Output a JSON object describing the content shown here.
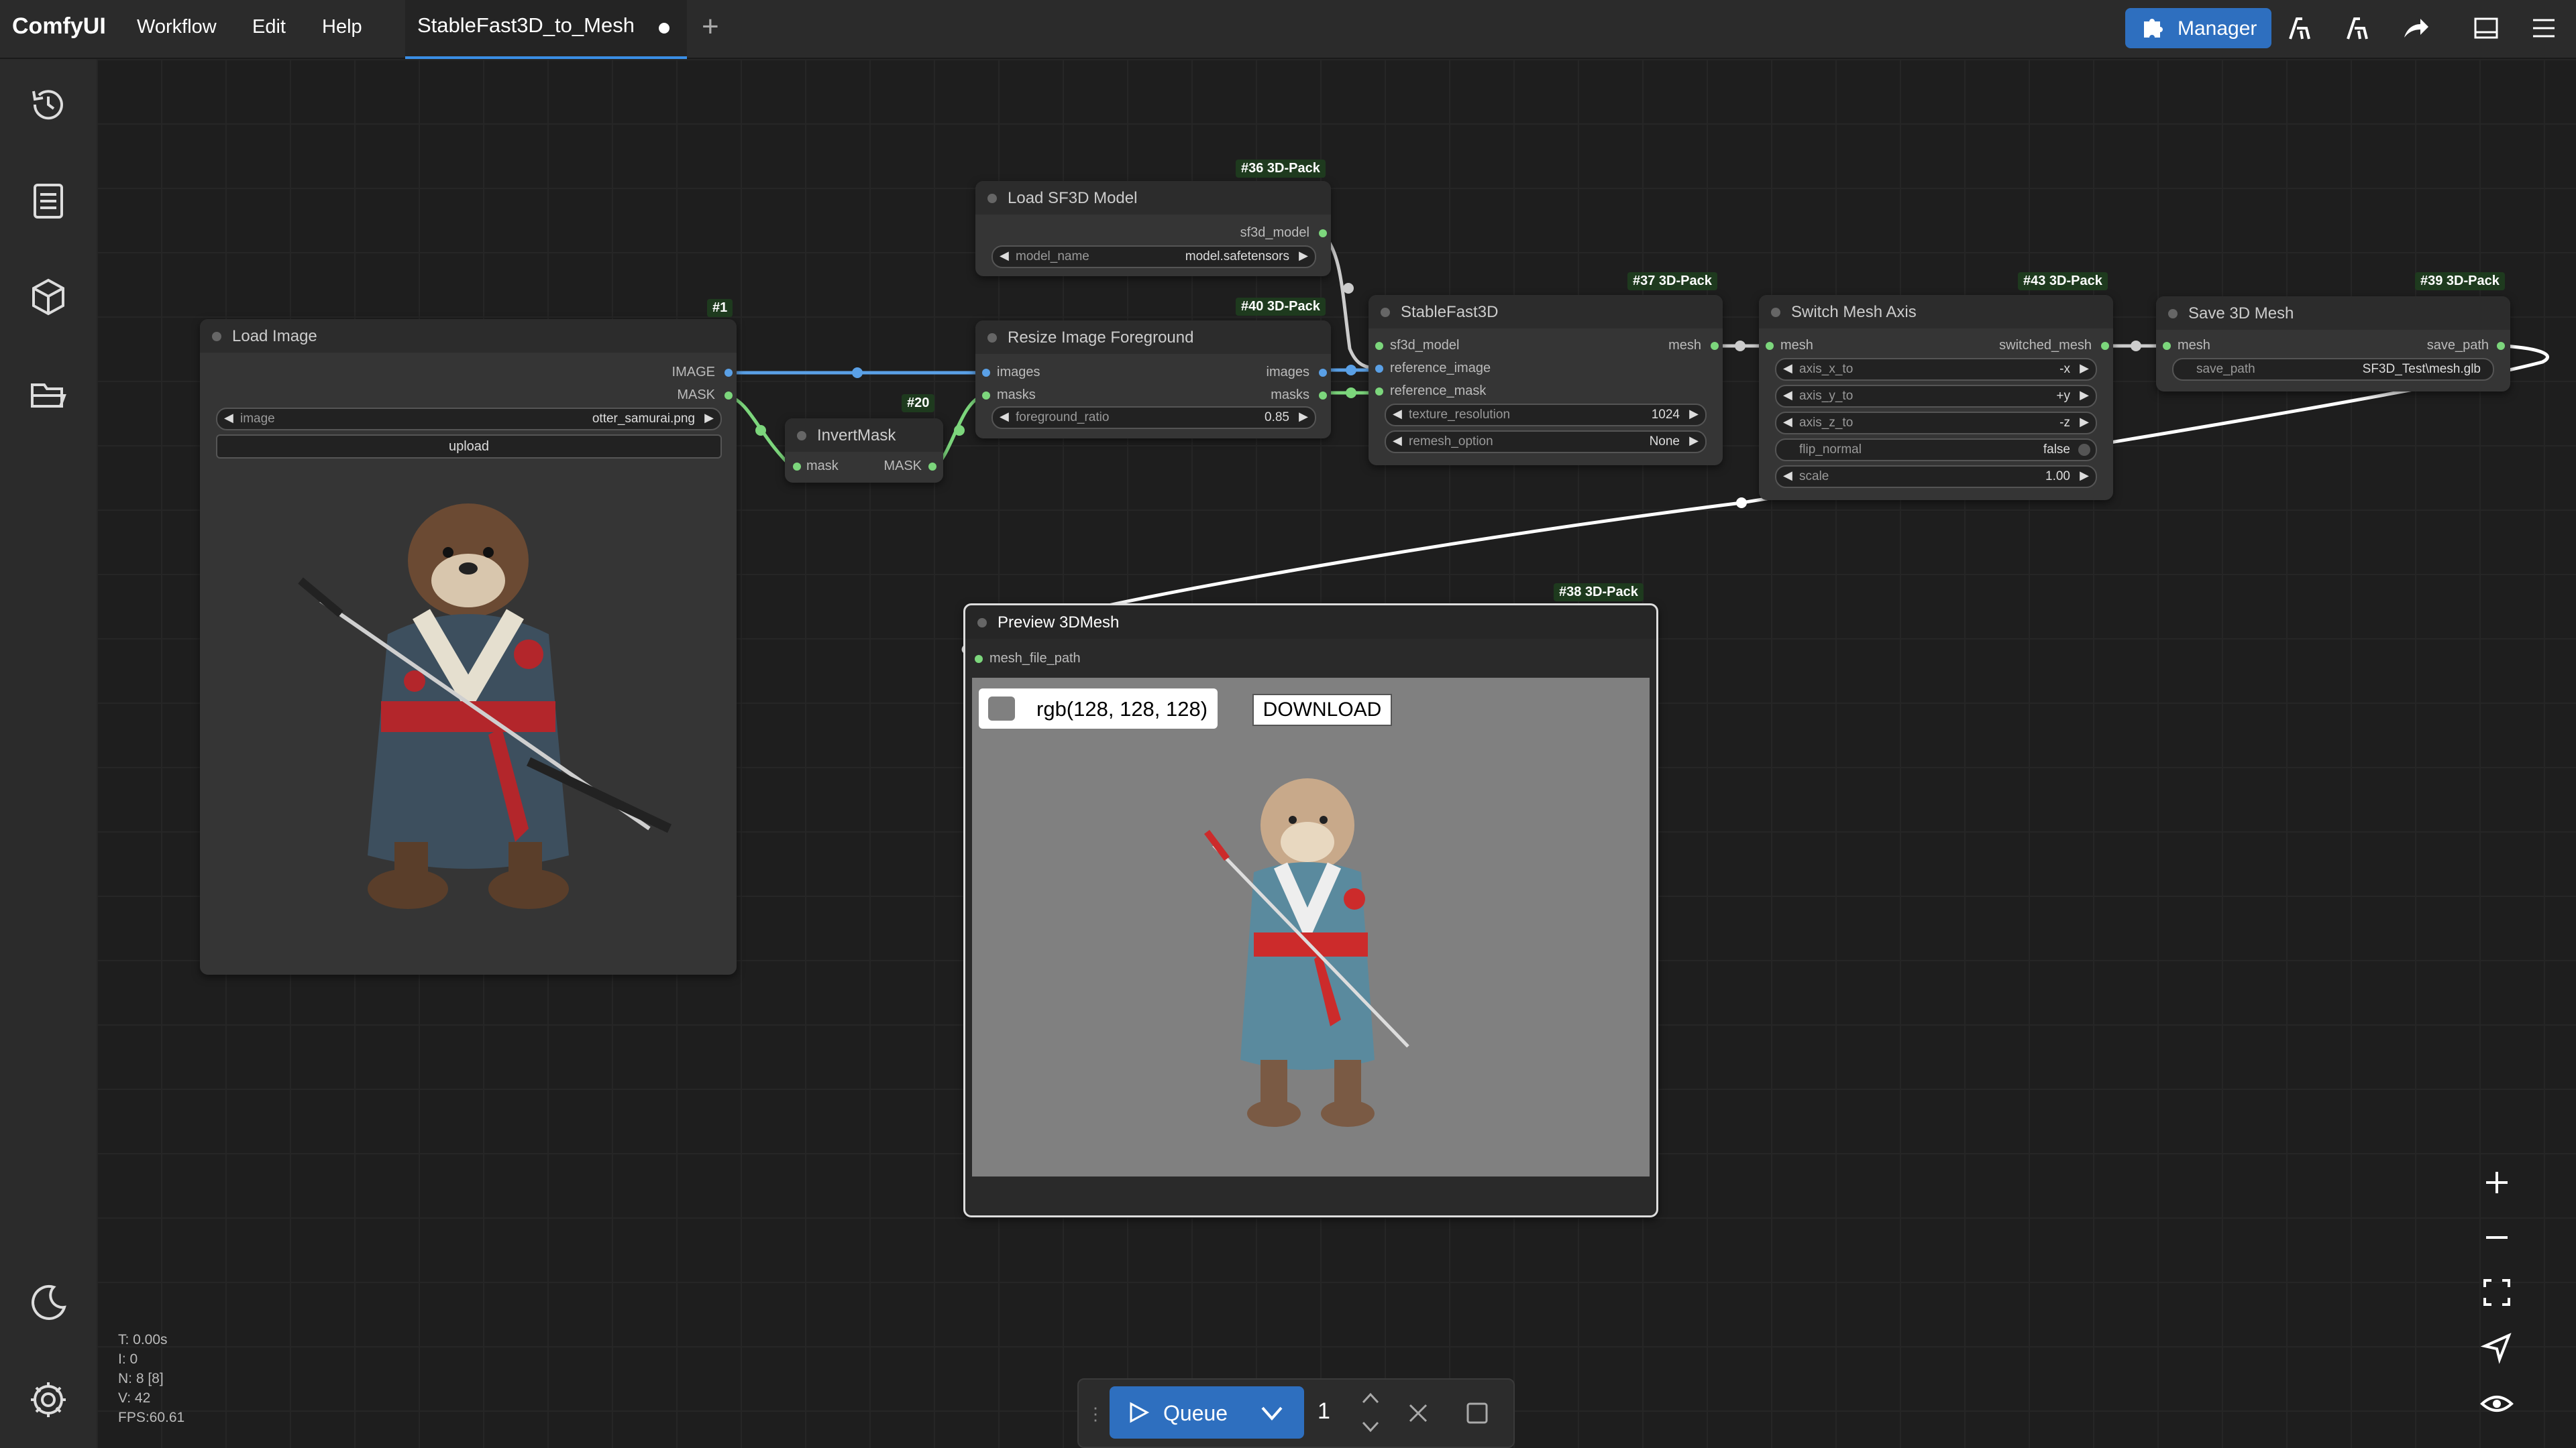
{
  "app": {
    "name": "ComfyUI"
  },
  "menu": {
    "workflow": "Workflow",
    "edit": "Edit",
    "help": "Help"
  },
  "tabs": [
    {
      "label": "StableFast3D_to_Mesh"
    }
  ],
  "toolbar": {
    "manager_label": "Manager"
  },
  "sidebar": {
    "items": [
      "history-icon",
      "queue-icon",
      "model-library-icon",
      "workflows-icon"
    ],
    "bottom": [
      "theme-toggle-icon",
      "settings-icon"
    ]
  },
  "nodes": {
    "load_image": {
      "title": "Load Image",
      "badge": "#1",
      "outputs": [
        "IMAGE",
        "MASK"
      ],
      "widget_image_label": "image",
      "widget_image_value": "otter_samurai.png",
      "upload_label": "upload"
    },
    "load_sf3d": {
      "title": "Load SF3D Model",
      "badge": "#36 3D-Pack",
      "output": "sf3d_model",
      "widget_label": "model_name",
      "widget_value": "model.safetensors"
    },
    "invert_mask": {
      "title": "InvertMask",
      "badge": "#20",
      "input": "mask",
      "output": "MASK"
    },
    "resize_fg": {
      "title": "Resize Image Foreground",
      "badge": "#40 3D-Pack",
      "inputs": [
        "images",
        "masks"
      ],
      "outputs": [
        "images",
        "masks"
      ],
      "widget_label": "foreground_ratio",
      "widget_value": "0.85"
    },
    "stablefast3d": {
      "title": "StableFast3D",
      "badge": "#37 3D-Pack",
      "inputs": [
        "sf3d_model",
        "reference_image",
        "reference_mask"
      ],
      "output": "mesh",
      "w1_label": "texture_resolution",
      "w1_value": "1024",
      "w2_label": "remesh_option",
      "w2_value": "None"
    },
    "switch_axis": {
      "title": "Switch Mesh Axis",
      "badge": "#43 3D-Pack",
      "input": "mesh",
      "output": "switched_mesh",
      "w": [
        {
          "label": "axis_x_to",
          "value": "-x"
        },
        {
          "label": "axis_y_to",
          "value": "+y"
        },
        {
          "label": "axis_z_to",
          "value": "-z"
        },
        {
          "label": "flip_normal",
          "value": "false"
        },
        {
          "label": "scale",
          "value": "1.00"
        }
      ]
    },
    "save_mesh": {
      "title": "Save 3D Mesh",
      "badge": "#39 3D-Pack",
      "input": "mesh",
      "output": "save_path",
      "widget_label": "save_path",
      "widget_value": "SF3D_Test\\mesh.glb"
    },
    "preview": {
      "title": "Preview 3DMesh",
      "badge": "#38 3D-Pack",
      "input": "mesh_file_path",
      "bg_color_label": "rgb(128, 128, 128)",
      "download_label": "DOWNLOAD"
    }
  },
  "stats": {
    "t": "T: 0.00s",
    "i": "I: 0",
    "n": "N: 8 [8]",
    "v": "V: 42",
    "fps": "FPS:60.61"
  },
  "queue": {
    "label": "Queue",
    "count": "1"
  },
  "colors": {
    "accent": "#2e6fbf",
    "link_green": "#7cd67c",
    "link_blue": "#5aa0e6",
    "preview_bg": "#808080"
  }
}
